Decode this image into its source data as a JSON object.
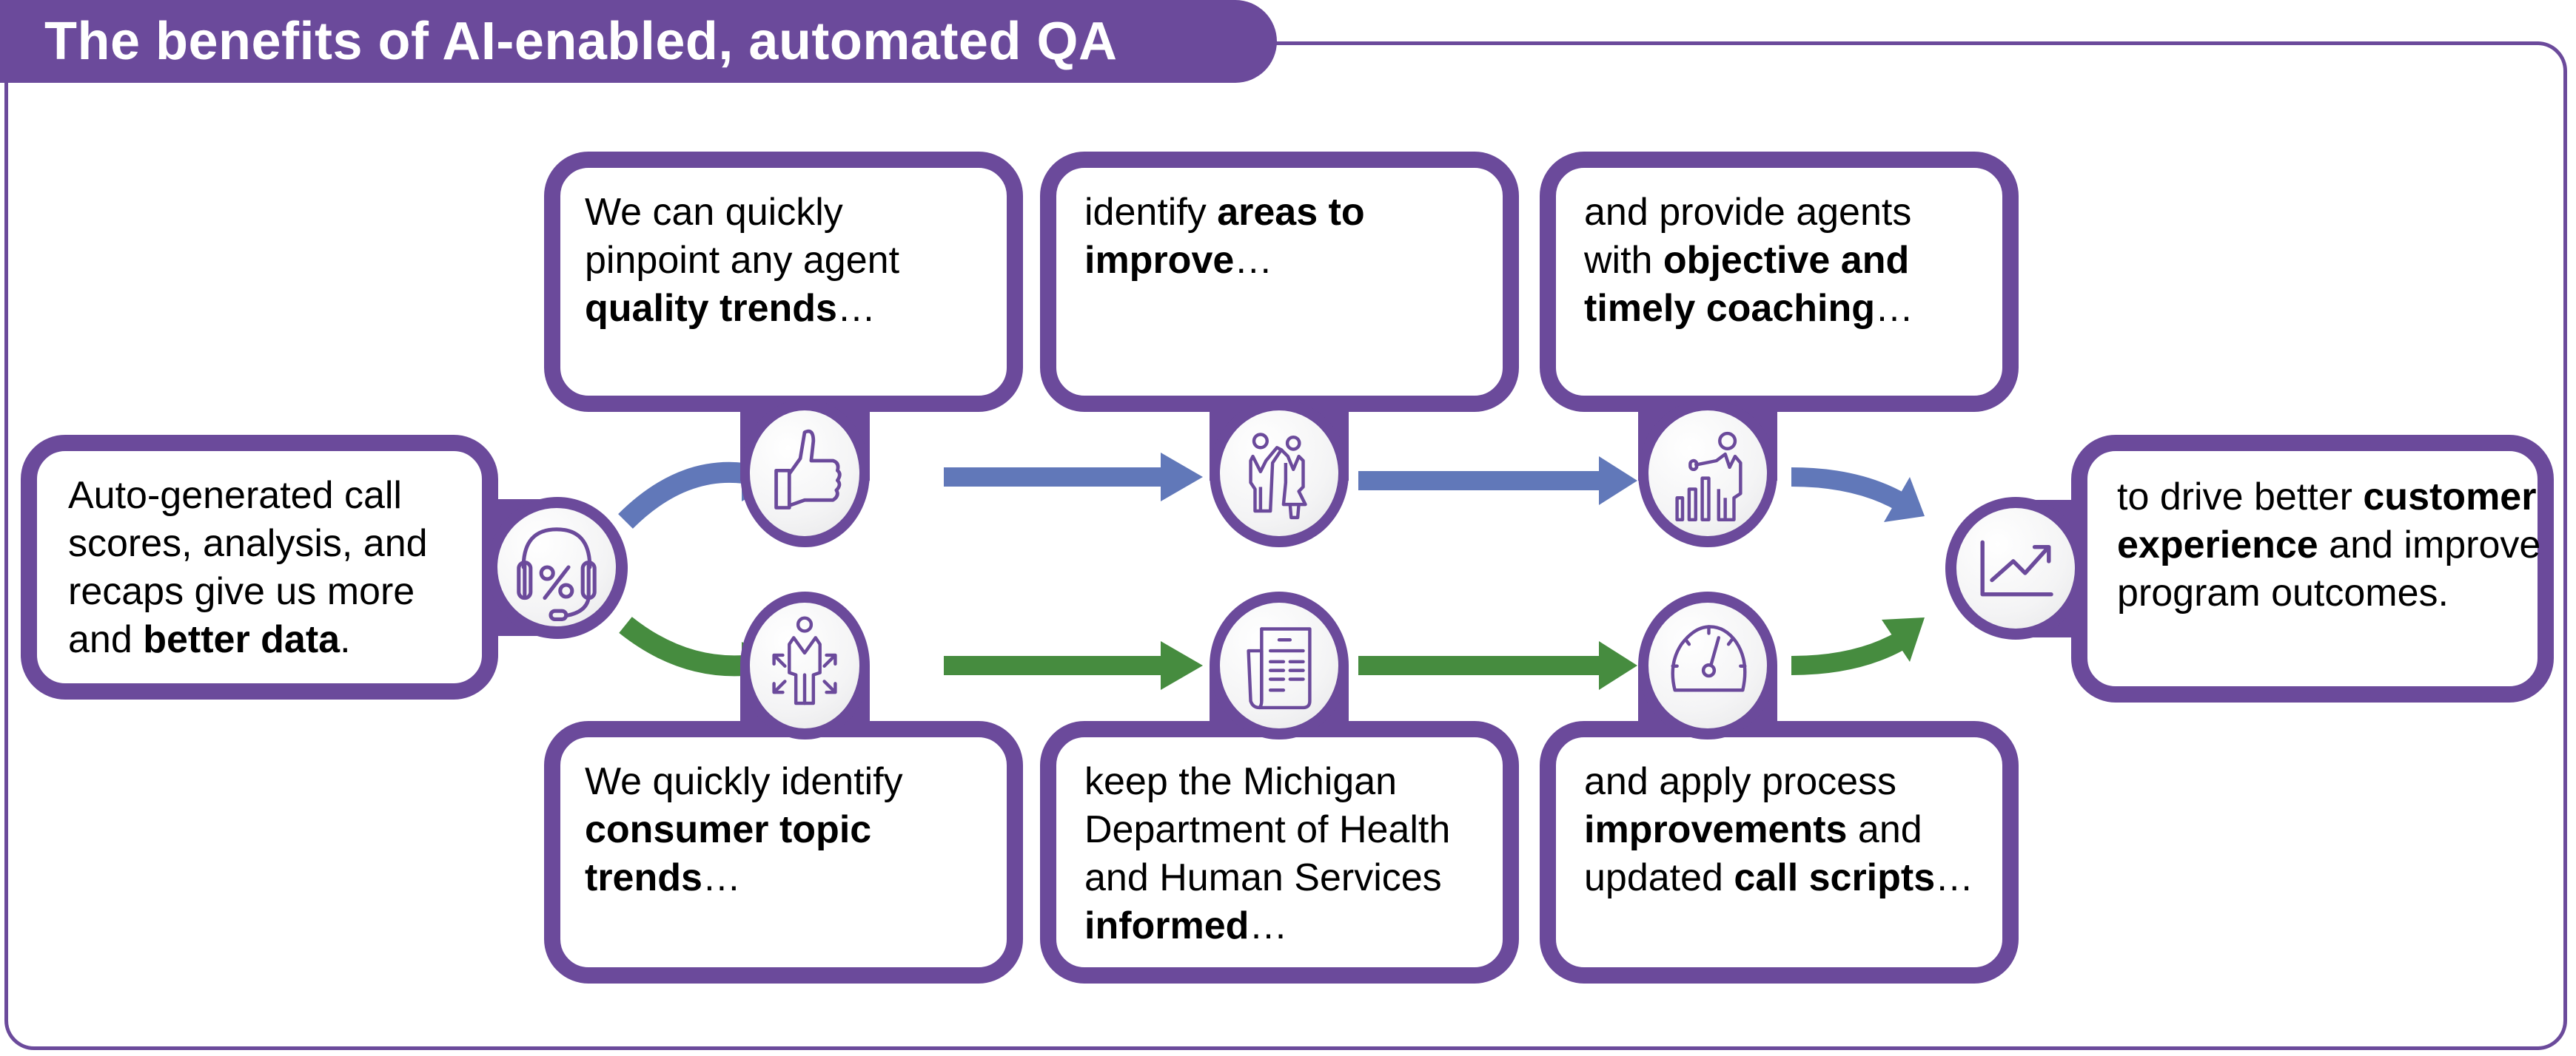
{
  "header": {
    "title": "The benefits of AI-enabled, automated QA"
  },
  "colors": {
    "brand_purple": "#6b4a9b",
    "flow_blue": "#6178b9",
    "flow_green": "#468c3f"
  },
  "source": {
    "icon": "headset-percent-icon",
    "text_plain_1": "Auto-generated call scores, analysis, and recaps give us more and ",
    "text_bold_1": "better data",
    "text_plain_2": "."
  },
  "top_row": [
    {
      "icon": "thumbs-up-icon",
      "text_plain_1": "We can quickly pinpoint any agent ",
      "text_bold_1": "quality trends",
      "text_plain_2": "…"
    },
    {
      "icon": "high-five-icon",
      "text_plain_1": "identify ",
      "text_bold_1": "areas to improve",
      "text_plain_2": "…"
    },
    {
      "icon": "presenter-chart-icon",
      "text_plain_1": "and provide agents with ",
      "text_bold_1": "objective and timely coaching",
      "text_plain_2": "…"
    }
  ],
  "bottom_row": [
    {
      "icon": "person-expand-icon",
      "text_plain_1": "We quickly identify ",
      "text_bold_1": "consumer topic trends",
      "text_plain_2": "…"
    },
    {
      "icon": "newspaper-icon",
      "text_plain_1": "keep the Michigan Department of Health and Human Services ",
      "text_bold_1": "informed",
      "text_plain_2": "…"
    },
    {
      "icon": "speedometer-icon",
      "text_plain_1": "and apply process ",
      "text_bold_1": "improvements",
      "text_plain_2": " and updated ",
      "text_bold_2": "call scripts",
      "text_plain_3": "…"
    }
  ],
  "outcome": {
    "icon": "trend-chart-icon",
    "text_plain_1": "to drive better ",
    "text_bold_1": "customer experience",
    "text_plain_2": " and improve program outcomes."
  }
}
